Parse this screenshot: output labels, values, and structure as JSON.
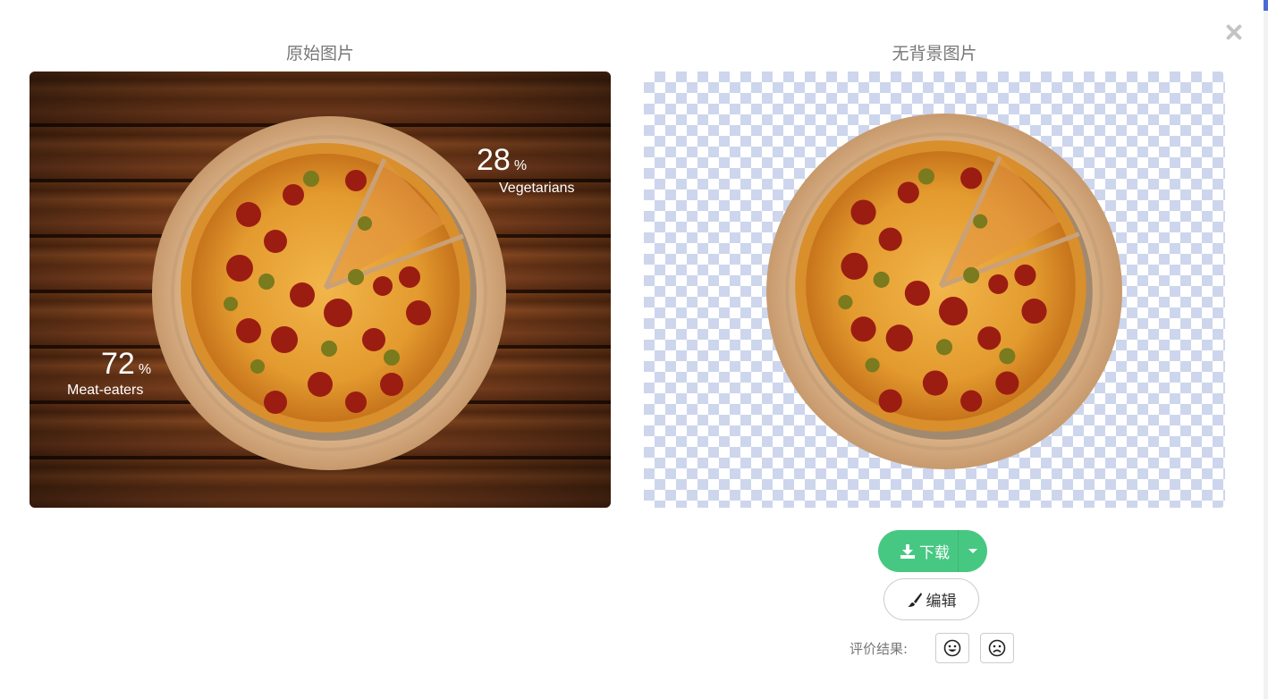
{
  "titles": {
    "original": "原始图片",
    "no_background": "无背景图片"
  },
  "image_overlay": {
    "veg_value": "28",
    "veg_unit": "%",
    "veg_label": "Vegetarians",
    "meat_value": "72",
    "meat_unit": "%",
    "meat_label": "Meat-eaters"
  },
  "actions": {
    "download_label": "下载",
    "edit_label": "编辑"
  },
  "rating": {
    "label": "评价结果:"
  },
  "icons": {
    "close": "close-icon",
    "download": "download-icon",
    "dropdown": "caret-down-icon",
    "edit": "brush-icon",
    "good": "smile-icon",
    "bad": "frown-icon"
  },
  "colors": {
    "accent_green": "#47c882",
    "checker": "#cdd6ec",
    "title_gray": "#777777"
  }
}
